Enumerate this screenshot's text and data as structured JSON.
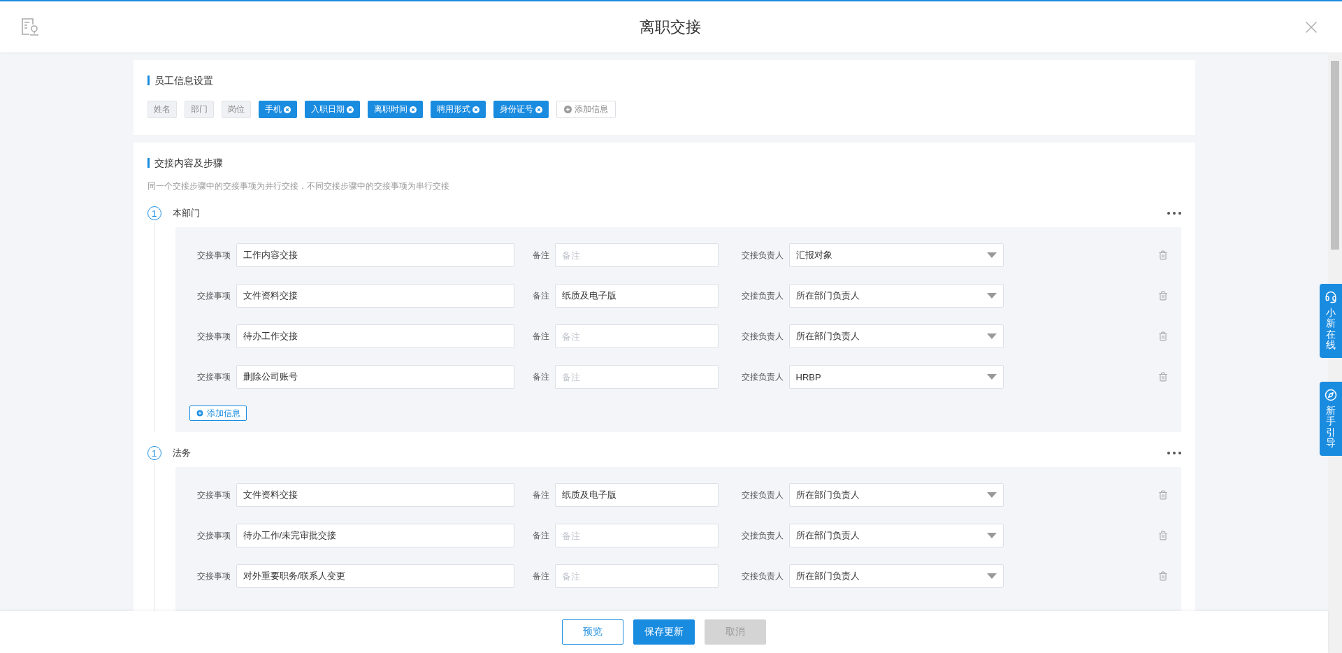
{
  "header": {
    "title": "离职交接"
  },
  "employee_info": {
    "title": "员工信息设置",
    "fields": [
      {
        "label": "姓名",
        "kind": "fixed"
      },
      {
        "label": "部门",
        "kind": "fixed"
      },
      {
        "label": "岗位",
        "kind": "fixed"
      },
      {
        "label": "手机",
        "kind": "removable"
      },
      {
        "label": "入职日期",
        "kind": "removable"
      },
      {
        "label": "离职时间",
        "kind": "removable"
      },
      {
        "label": "聘用形式",
        "kind": "removable"
      },
      {
        "label": "身份证号",
        "kind": "removable"
      }
    ],
    "add_button": "添加信息"
  },
  "handover": {
    "title": "交接内容及步骤",
    "hint": "同一个交接步骤中的交接事项为并行交接，不同交接步骤中的交接事项为串行交接",
    "steps": [
      {
        "number": "1",
        "name": "本部门",
        "items": [
          {
            "item_label": "交接事项",
            "item": "工作内容交接",
            "note_label": "备注",
            "placeholder": "备注",
            "owner_label": "交接负责人",
            "owner": "汇报对象"
          },
          {
            "item_label": "交接事项",
            "item": "文件资料交接",
            "note_label": "备注",
            "note": "纸质及电子版",
            "owner_label": "交接负责人",
            "owner": "所在部门负责人"
          },
          {
            "item_label": "交接事项",
            "item": "待办工作交接",
            "note_label": "备注",
            "placeholder": "备注",
            "owner_label": "交接负责人",
            "owner": "所在部门负责人"
          },
          {
            "item_label": "交接事项",
            "item": "删除公司账号",
            "note_label": "备注",
            "placeholder": "备注",
            "owner_label": "交接负责人",
            "owner": "HRBP"
          }
        ],
        "add_button": "添加信息"
      },
      {
        "number": "1",
        "name": "法务",
        "items": [
          {
            "item_label": "交接事项",
            "item": "文件资料交接",
            "note_label": "备注",
            "note": "纸质及电子版",
            "owner_label": "交接负责人",
            "owner": "所在部门负责人"
          },
          {
            "item_label": "交接事项",
            "item": "待办工作/未完审批交接",
            "note_label": "备注",
            "placeholder": "备注",
            "owner_label": "交接负责人",
            "owner": "所在部门负责人"
          },
          {
            "item_label": "交接事项",
            "item": "对外重要职务/联系人变更",
            "note_label": "备注",
            "placeholder": "备注",
            "owner_label": "交接负责人",
            "owner": "所在部门负责人"
          }
        ]
      }
    ]
  },
  "side_buttons": [
    {
      "label": "小新在线",
      "kind": "headset"
    },
    {
      "label": "新手引导",
      "kind": "compass"
    }
  ],
  "footer": {
    "buttons": [
      {
        "label": "预览",
        "kind": "outline",
        "disabled": false
      },
      {
        "label": "保存更新",
        "kind": "primary",
        "disabled": false
      },
      {
        "label": "取消",
        "kind": "primary",
        "disabled": true
      }
    ]
  }
}
